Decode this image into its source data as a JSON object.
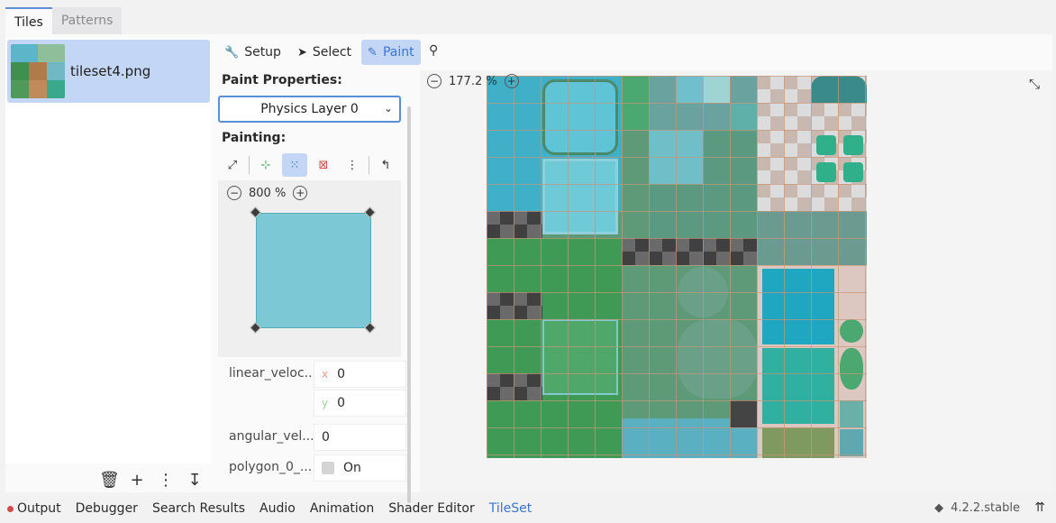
{
  "top_tabs": [
    "Tiles",
    "Patterns"
  ],
  "tileset": {
    "name": "tileset4.png"
  },
  "left_tools": {
    "remove": "🗑",
    "add": "+",
    "menu": "⋮",
    "sort": "↧"
  },
  "modes": [
    {
      "label": "Setup",
      "icon": "wrench-icon"
    },
    {
      "label": "Select",
      "icon": "pointer-icon"
    },
    {
      "label": "Paint",
      "icon": "brush-icon"
    }
  ],
  "paint": {
    "properties_label": "Paint Properties:",
    "layer": "Physics Layer 0",
    "painting_label": "Painting:"
  },
  "preview": {
    "zoom": "800 %"
  },
  "props": {
    "linear_velocity": {
      "name": "linear_veloc...",
      "x_axis": "x",
      "x": "0",
      "y_axis": "y",
      "y": "0"
    },
    "angular_velocity": {
      "name": "angular_vel...",
      "value": "0"
    },
    "polygon": {
      "name": "polygon_0_...",
      "value": "On"
    }
  },
  "atlas": {
    "zoom": "177.2 %"
  },
  "bottom_tabs": [
    "Output",
    "Debugger",
    "Search Results",
    "Audio",
    "Animation",
    "Shader Editor",
    "TileSet"
  ],
  "version": "4.2.2.stable",
  "colors": {
    "accent": "#3a74d0",
    "selected": "#c3d6f6",
    "water": "#7cc8d4"
  }
}
